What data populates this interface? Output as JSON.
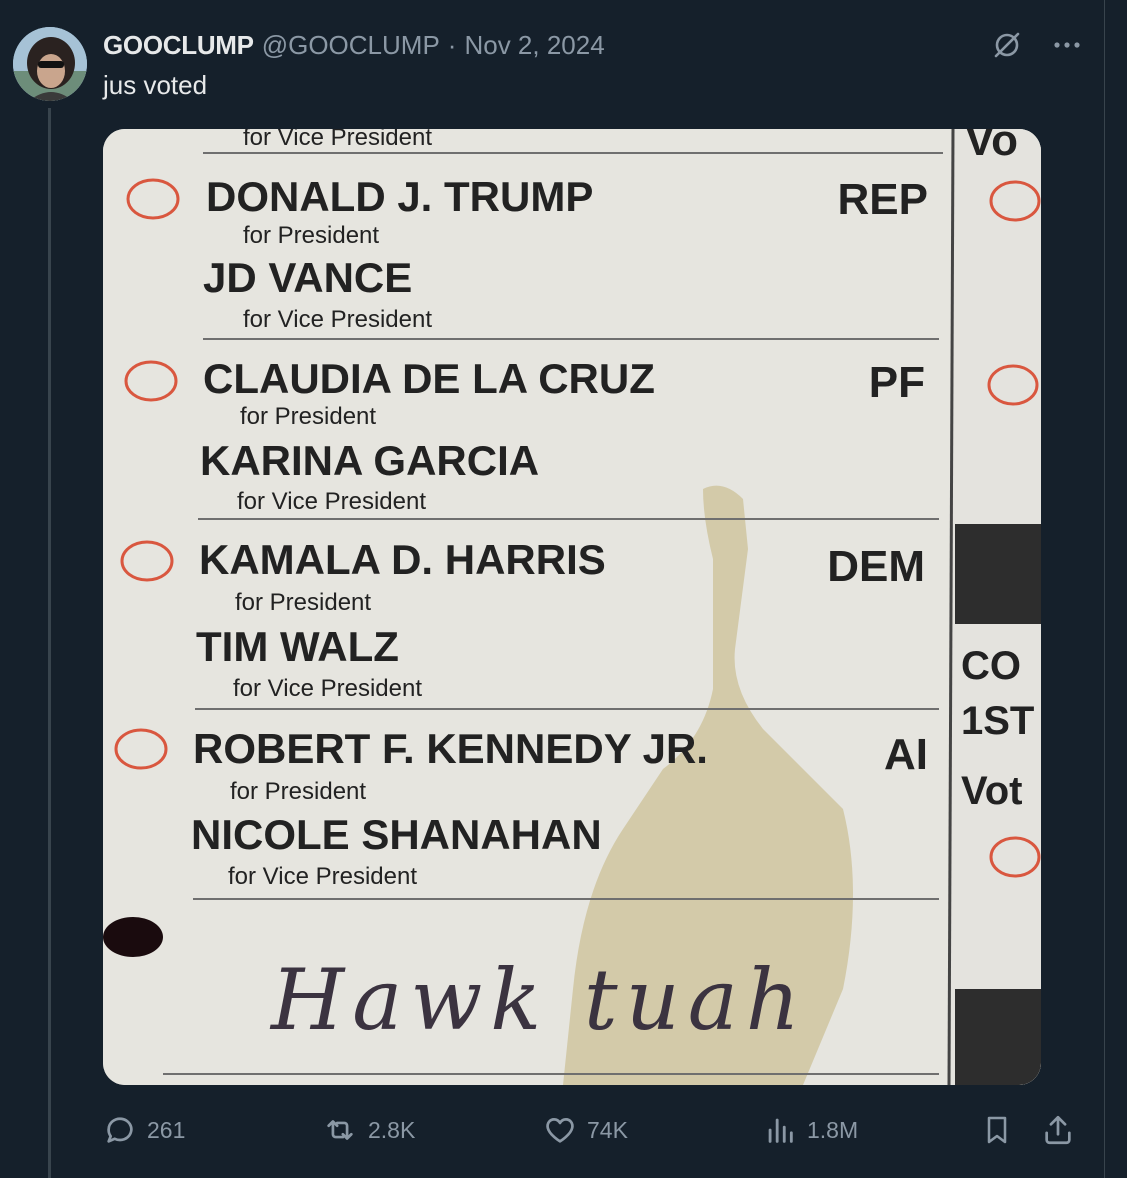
{
  "tweet": {
    "display_name": "GOOCLUMP",
    "handle": "@GOOCLUMP",
    "separator": "·",
    "date": "Nov 2, 2024",
    "text": "jus voted"
  },
  "header_icons": [
    "grok-icon",
    "more-icon"
  ],
  "ballot": {
    "top_cut_label": "for Vice President",
    "candidates": [
      {
        "president": "DONALD J. TRUMP",
        "president_role": "for President",
        "vice": "JD VANCE",
        "vice_role": "for Vice President",
        "party": "REP"
      },
      {
        "president": "CLAUDIA DE LA CRUZ",
        "president_role": "for President",
        "vice": "KARINA GARCIA",
        "vice_role": "for Vice President",
        "party": "PF"
      },
      {
        "president": "KAMALA D. HARRIS",
        "president_role": "for President",
        "vice": "TIM WALZ",
        "vice_role": "for Vice President",
        "party": "DEM"
      },
      {
        "president": "ROBERT F. KENNEDY JR.",
        "president_role": "for President",
        "vice": "NICOLE SHANAHAN",
        "vice_role": "for Vice President",
        "party": "AI"
      }
    ],
    "write_in": "Hawk tuah",
    "right_column": {
      "top": "Vo",
      "mid_1": "CO",
      "mid_2": "1ST",
      "mid_3": "Vot"
    }
  },
  "actions": {
    "replies": "261",
    "reposts": "2.8K",
    "likes": "74K",
    "views": "1.8M"
  },
  "colors": {
    "background": "#15202b",
    "text_primary": "#e7e9ea",
    "text_secondary": "#8b98a5",
    "divider": "#38444d",
    "ballot_oval": "#d9573f"
  }
}
